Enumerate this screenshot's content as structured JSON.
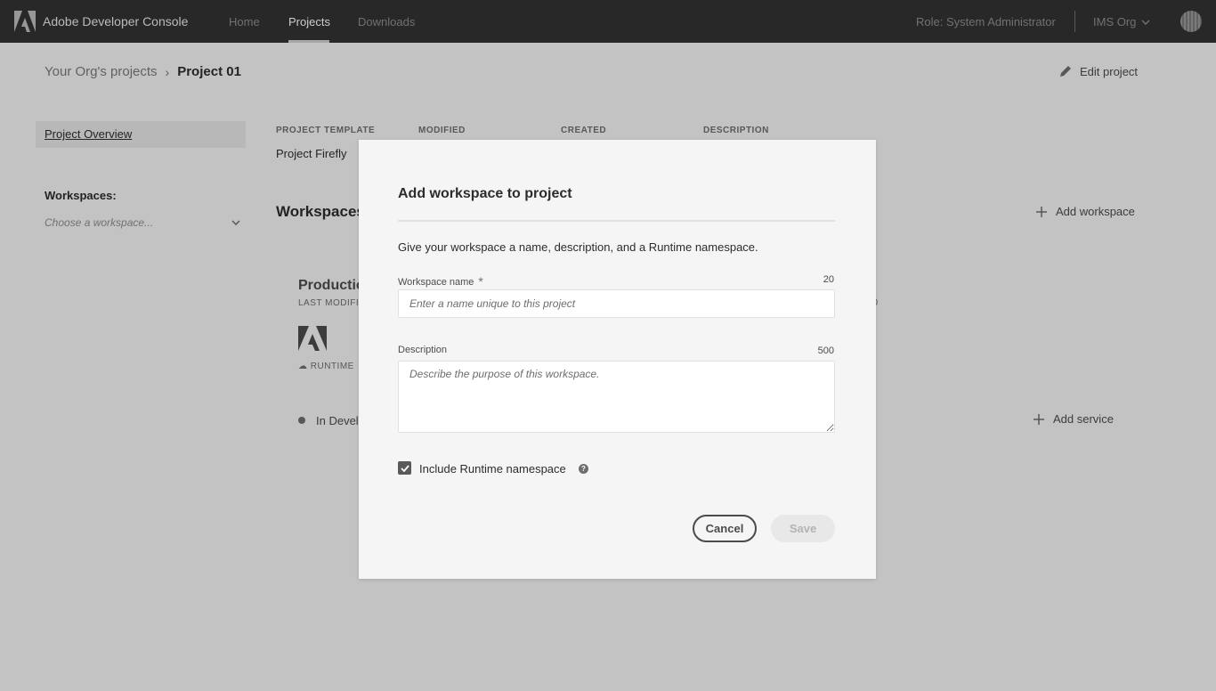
{
  "nav": {
    "brand": "Adobe Developer Console",
    "links": [
      "Home",
      "Projects",
      "Downloads"
    ],
    "active_link": "Projects",
    "role": "Role: System Administrator",
    "org": "IMS Org"
  },
  "breadcrumb": {
    "parent": "Your Org's projects",
    "separator": "›",
    "current": "Project 01"
  },
  "edit_project": "Edit project",
  "sidebar": {
    "overview": "Project Overview",
    "workspaces_label": "Workspaces:",
    "workspace_select_placeholder": "Choose a workspace..."
  },
  "overview": {
    "columns": [
      "PROJECT TEMPLATE",
      "MODIFIED",
      "CREATED",
      "DESCRIPTION"
    ],
    "template_value": "Project Firefly",
    "workspaces_heading": "Workspaces",
    "add_workspace": "Add workspace",
    "production_title": "Productio",
    "last_modified_label": "LAST MODIFI",
    "runtime_tag": "RUNTIME",
    "status": "In Develo",
    "add_service": "Add service",
    "trailing_value": "0"
  },
  "modal": {
    "title": "Add workspace to project",
    "description": "Give your workspace a name, description, and a Runtime namespace.",
    "name_label": "Workspace name",
    "name_required_mark": "*",
    "name_max": "20",
    "name_placeholder": "Enter a name unique to this project",
    "desc_label": "Description",
    "desc_max": "500",
    "desc_placeholder": "Describe the purpose of this workspace.",
    "include_runtime_label": "Include Runtime namespace",
    "include_runtime_checked": true,
    "help_glyph": "?",
    "cancel": "Cancel",
    "save": "Save"
  },
  "colors": {
    "topnav_bg": "#323232",
    "page_bg": "#f4f4f4",
    "modal_bg": "#f5f5f5",
    "checkbox": "#5a5a5a"
  }
}
